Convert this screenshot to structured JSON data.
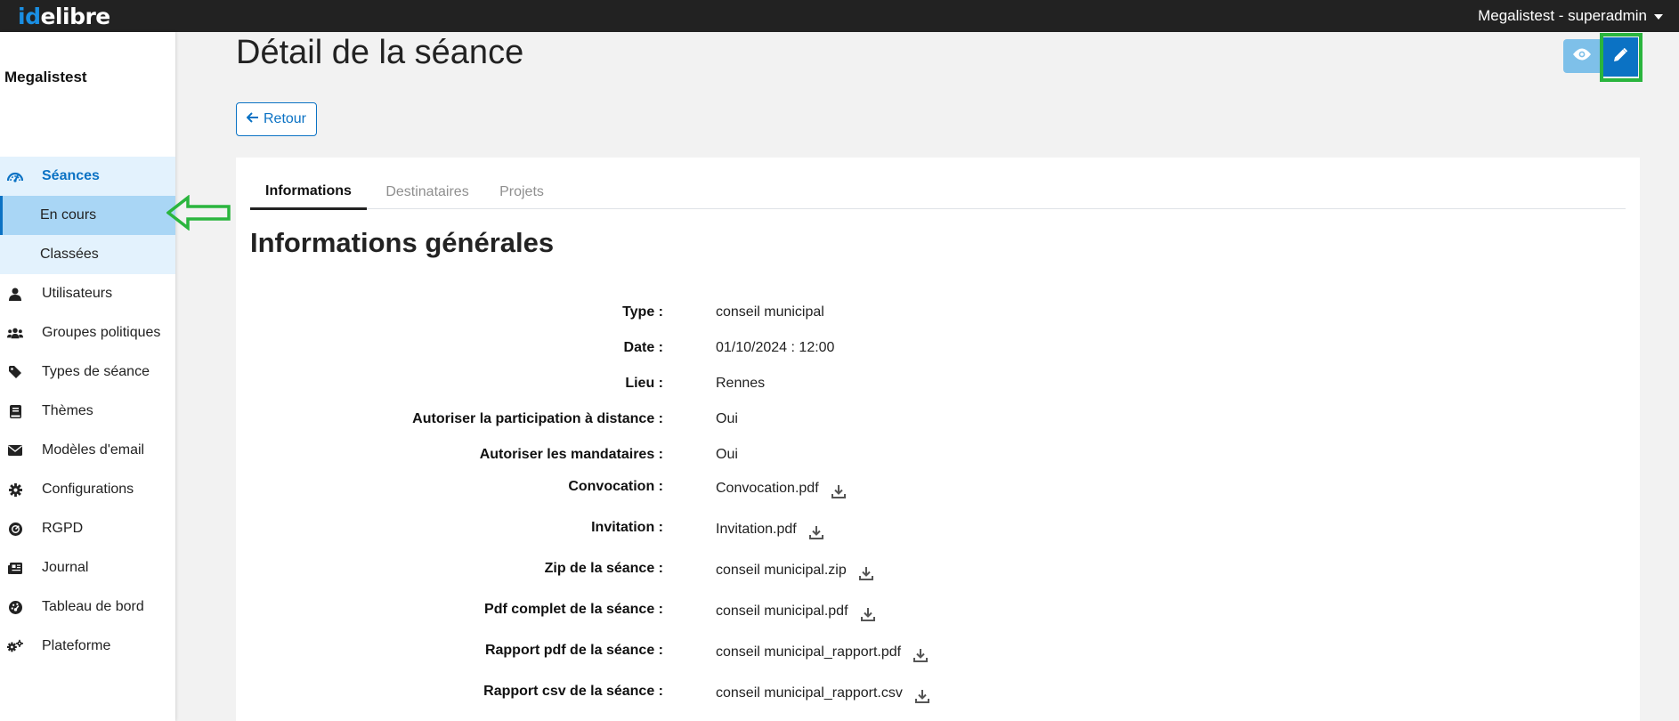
{
  "app": {
    "logo_id": "id",
    "logo_rest": "elibre",
    "user": "Megalistest - superadmin"
  },
  "sidebar": {
    "org": "Megalistest",
    "section": "Séances",
    "sub": [
      "En cours",
      "Classées"
    ],
    "items": [
      {
        "label": "Utilisateurs",
        "icon": "user-icon"
      },
      {
        "label": "Groupes politiques",
        "icon": "users-icon"
      },
      {
        "label": "Types de séance",
        "icon": "tag-icon"
      },
      {
        "label": "Thèmes",
        "icon": "book-icon"
      },
      {
        "label": "Modèles d'email",
        "icon": "envelope-icon"
      },
      {
        "label": "Configurations",
        "icon": "gear-icon"
      },
      {
        "label": "RGPD",
        "icon": "rgpd-icon"
      },
      {
        "label": "Journal",
        "icon": "newspaper-icon"
      },
      {
        "label": "Tableau de bord",
        "icon": "dashboard-icon"
      },
      {
        "label": "Plateforme",
        "icon": "gears-icon"
      }
    ]
  },
  "main": {
    "title": "Détail de la séance",
    "back_label": "Retour",
    "tabs": [
      "Informations",
      "Destinataires",
      "Projets"
    ],
    "section_title": "Informations générales",
    "fields": [
      {
        "key": "Type :",
        "value": "conseil municipal"
      },
      {
        "key": "Date :",
        "value": "01/10/2024 : 12:00"
      },
      {
        "key": "Lieu :",
        "value": "Rennes"
      },
      {
        "key": "Autoriser la participation à distance :",
        "value": "Oui"
      },
      {
        "key": "Autoriser les mandataires :",
        "value": "Oui"
      },
      {
        "key": "Convocation :",
        "value": "Convocation.pdf"
      },
      {
        "key": "Invitation :",
        "value": "Invitation.pdf"
      },
      {
        "key": "Zip de la séance :",
        "value": "conseil municipal.zip"
      },
      {
        "key": "Pdf complet de la séance :",
        "value": "conseil municipal.pdf"
      },
      {
        "key": "Rapport pdf de la séance :",
        "value": "conseil municipal_rapport.pdf"
      },
      {
        "key": "Rapport csv de la séance :",
        "value": "conseil municipal_rapport.csv"
      }
    ]
  },
  "colors": {
    "accent": "#0b72c4",
    "topbar": "#222222",
    "annotation": "#2ab53e"
  }
}
